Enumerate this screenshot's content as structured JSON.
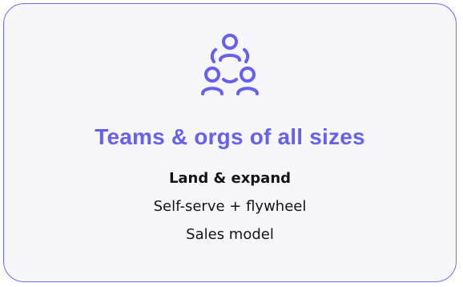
{
  "card": {
    "icon": "team-network-icon",
    "title": "Teams & orgs of all sizes",
    "lines": [
      "Land & expand",
      "Self-serve + flywheel",
      "Sales model"
    ]
  },
  "colors": {
    "accent": "#6660ef",
    "border": "#6f6cf0",
    "background": "#f7f7f9",
    "text": "#141414"
  }
}
